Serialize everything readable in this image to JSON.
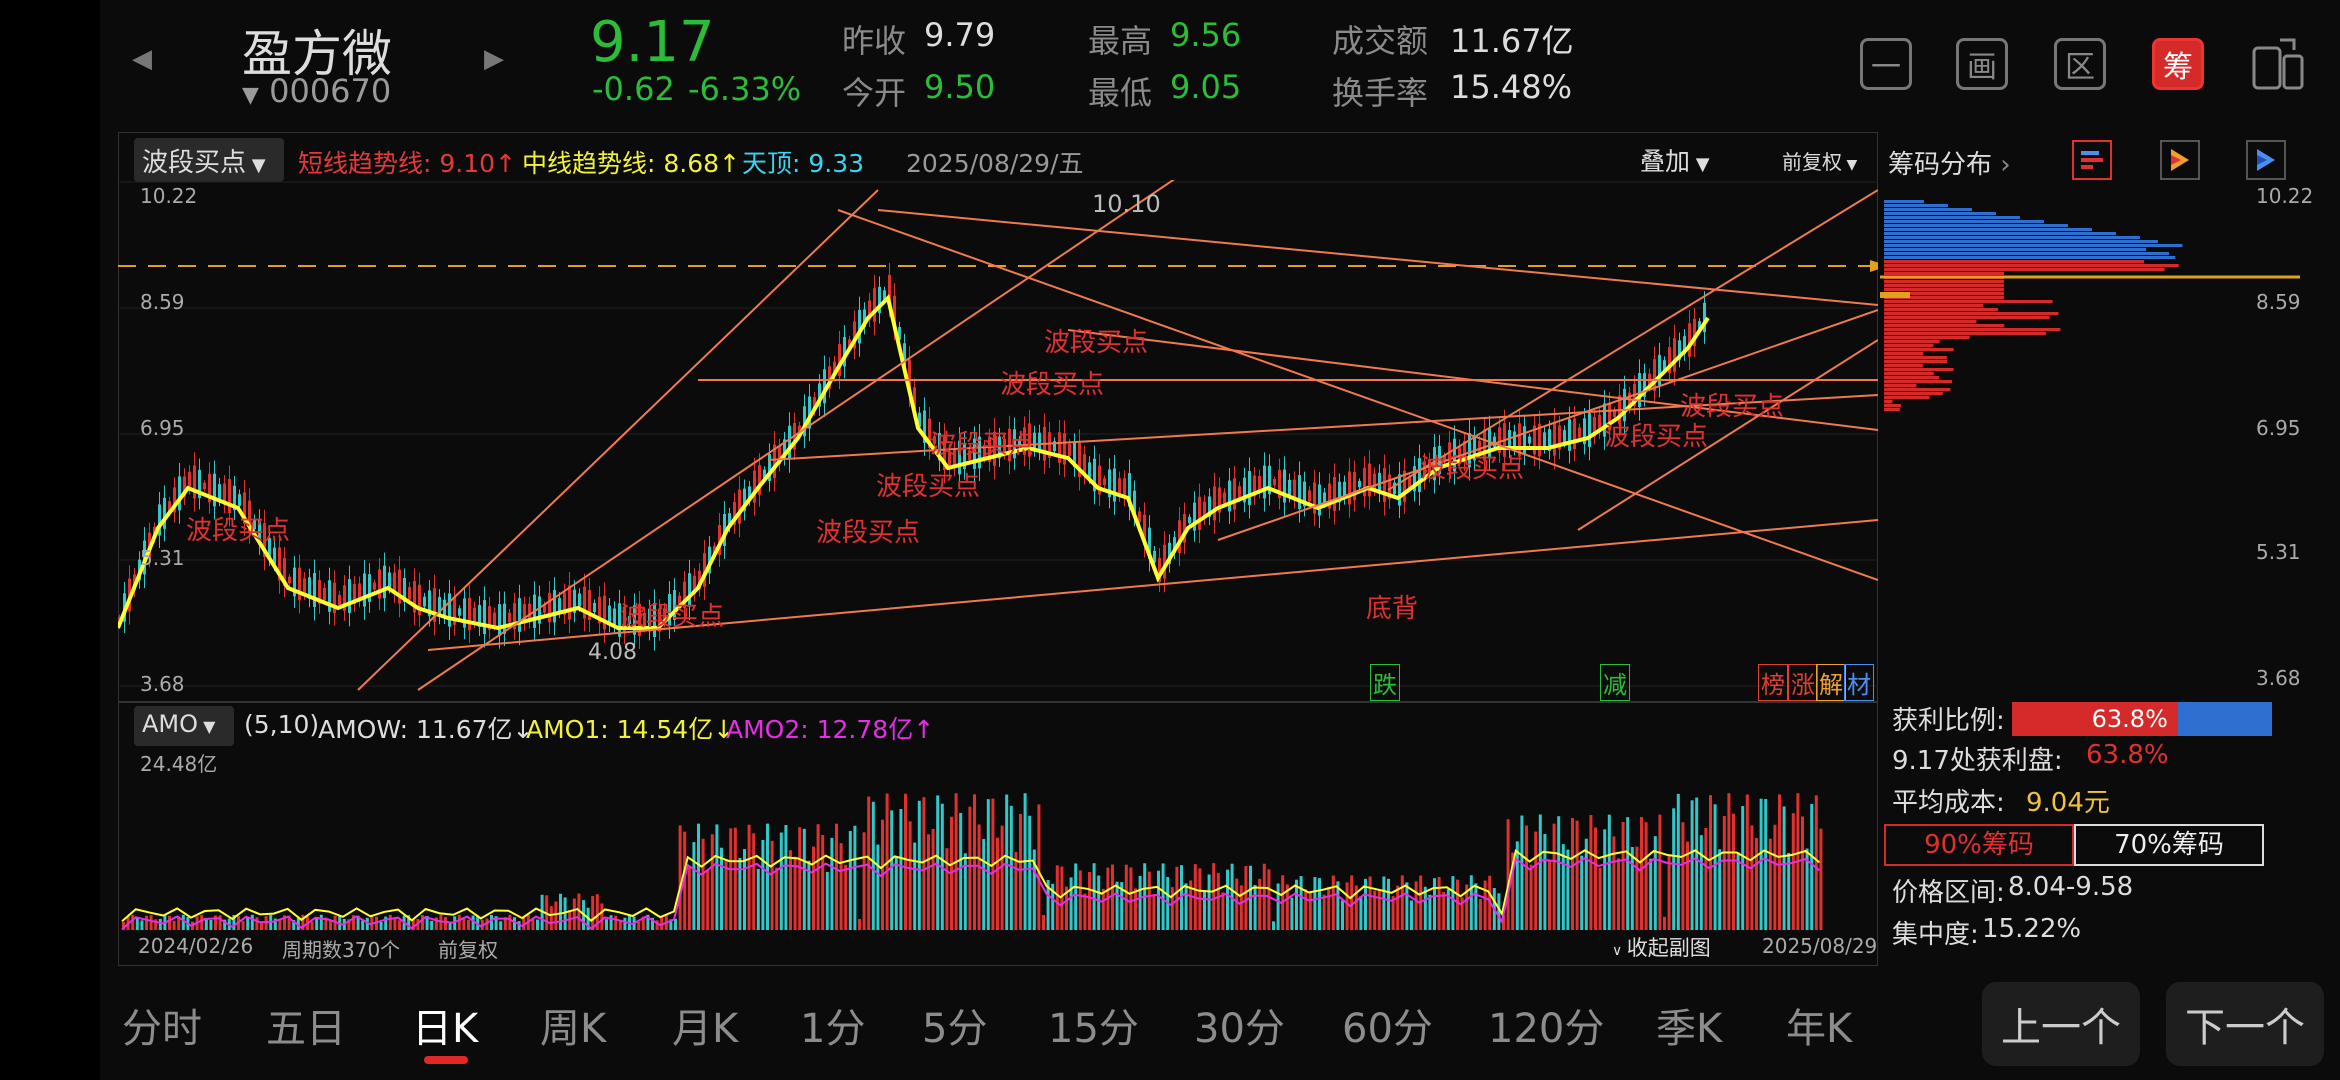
{
  "header": {
    "stock_name": "盈方微",
    "stock_code": "000670",
    "price": "9.17",
    "change": "-0.62",
    "change_pct": "-6.33%",
    "quotes": [
      {
        "label": "昨收",
        "value": "9.79"
      },
      {
        "label": "今开",
        "value": "9.50"
      },
      {
        "label": "最高",
        "value": "9.56"
      },
      {
        "label": "最低",
        "value": "9.05"
      },
      {
        "label": "成交额",
        "value": "11.67亿"
      },
      {
        "label": "换手率",
        "value": "15.48%"
      }
    ],
    "tool_buttons": [
      "一",
      "画",
      "区",
      "筹"
    ]
  },
  "kline": {
    "indicator_select": "波段买点",
    "short_trend": "短线趋势线: 9.10↑",
    "mid_trend": "中线趋势线: 8.68↑",
    "top": "天顶: 9.33",
    "date": "2025/08/29/五",
    "overlay": "叠加",
    "adjust": "前复权",
    "y_ticks": [
      "10.22",
      "8.59",
      "6.95",
      "5.31",
      "3.68"
    ],
    "high_label": "10.10",
    "low_label": "4.08",
    "buy_label": "波段买点",
    "div_label": "底背",
    "signals": [
      "跌",
      "减",
      "榜",
      "涨",
      "解",
      "材"
    ],
    "colors": {
      "up": "#e0312f",
      "down": "#30c8c8",
      "ma5": "#ffff33",
      "ma10": "#e52ee5",
      "trendline": "#f07a50"
    }
  },
  "chips": {
    "title": "筹码分布",
    "profit_label": "获利比例:",
    "profit_ratio": "63.8%",
    "profit_value": 0.638,
    "profit_at_label": "9.17处获利盘:",
    "profit_at_value": "63.8%",
    "avg_cost_label": "平均成本:",
    "avg_cost": "9.04元",
    "tab90": "90%筹码",
    "tab70": "70%筹码",
    "range_label": "价格区间:",
    "range": "8.04-9.58",
    "conc_label": "集中度:",
    "concentration": "15.22%"
  },
  "volume": {
    "indicator": "AMO",
    "params": "(5,10)",
    "amow": "AMOW: 11.67亿↓",
    "amo1": "AMO1: 14.54亿↓",
    "amo2": "AMO2: 12.78亿↑",
    "max": "24.48亿",
    "start_date": "2024/02/26",
    "period_count": "周期数370个",
    "adjust": "前复权",
    "collapse": "收起副图",
    "end_date": "2025/08/29"
  },
  "tabs": [
    "分时",
    "五日",
    "日K",
    "周K",
    "月K",
    "1分",
    "5分",
    "15分",
    "30分",
    "60分",
    "120分",
    "季K",
    "年K"
  ],
  "active_tab": "日K",
  "nav": {
    "prev": "上一个",
    "next": "下一个"
  }
}
